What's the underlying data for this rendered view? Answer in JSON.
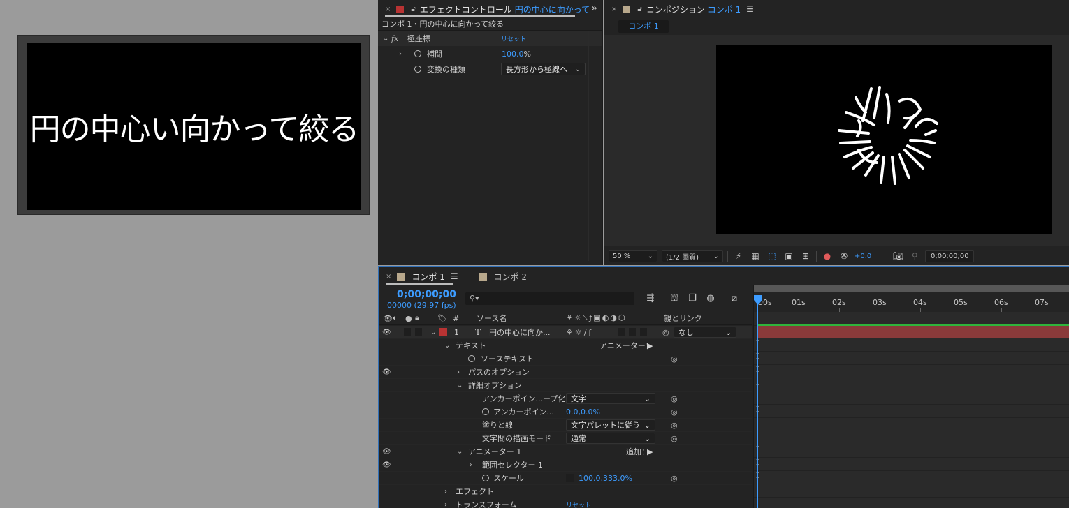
{
  "preview": {
    "text": "円の中心い向かって絞る"
  },
  "effect_controls": {
    "tab_title": "エフェクトコントロール",
    "tab_layer": "円の中心に向かって",
    "layer_label": "コンポ 1・円の中心に向かって絞る",
    "effect_name": "極座標",
    "reset": "リセット",
    "interp_label": "補間",
    "interp_value": "100.0",
    "interp_unit": "%",
    "conv_label": "変換の種類",
    "conv_value": "長方形から極線へ",
    "fx": "fx"
  },
  "composition": {
    "tab_title": "コンポジション",
    "tab_comp": "コンポ 1",
    "subtab": "コンポ 1",
    "zoom": "50 %",
    "quality": "(1/2 画質)",
    "exposure": "+0.0",
    "timecode": "0;00;00;00"
  },
  "timeline": {
    "tab1": "コンポ 1",
    "tab2": "コンポ 2",
    "timecode": "0;00;00;00",
    "fps": "00000 (29.97 fps)",
    "col_source": "ソース名",
    "col_parent": "親とリンク",
    "hash": "#",
    "ruler": [
      "00s",
      "01s",
      "02s",
      "03s",
      "04s",
      "05s",
      "06s",
      "07s"
    ],
    "layer": {
      "num": "1",
      "type": "T",
      "name": "円の中心に向か...",
      "parent": "なし"
    },
    "rows": {
      "text": "テキスト",
      "animator_label": "アニメーター：",
      "source_text": "ソーステキスト",
      "path_options": "パスのオプション",
      "more_options": "詳細オプション",
      "anchor_group": "アンカーポイン...ープ化",
      "anchor_group_value": "文字",
      "anchor": "アンカーポイン...",
      "anchor_value": "0.0,0.0%",
      "fill_stroke": "塗りと線",
      "fill_stroke_value": "文字パレットに従う",
      "blend": "文字間の描画モード",
      "blend_value": "通常",
      "animator1": "アニメーター 1",
      "add_label": "追加：",
      "range_selector": "範囲セレクター 1",
      "scale": "スケール",
      "scale_value": "100.0,333.0%",
      "effects": "エフェクト",
      "transform": "トランスフォーム",
      "reset": "リセット"
    }
  },
  "colors": {
    "accent": "#3d9cff",
    "layer_red": "#b83333",
    "comp_swatch": "#b8a88c",
    "green": "#2fb43b"
  }
}
